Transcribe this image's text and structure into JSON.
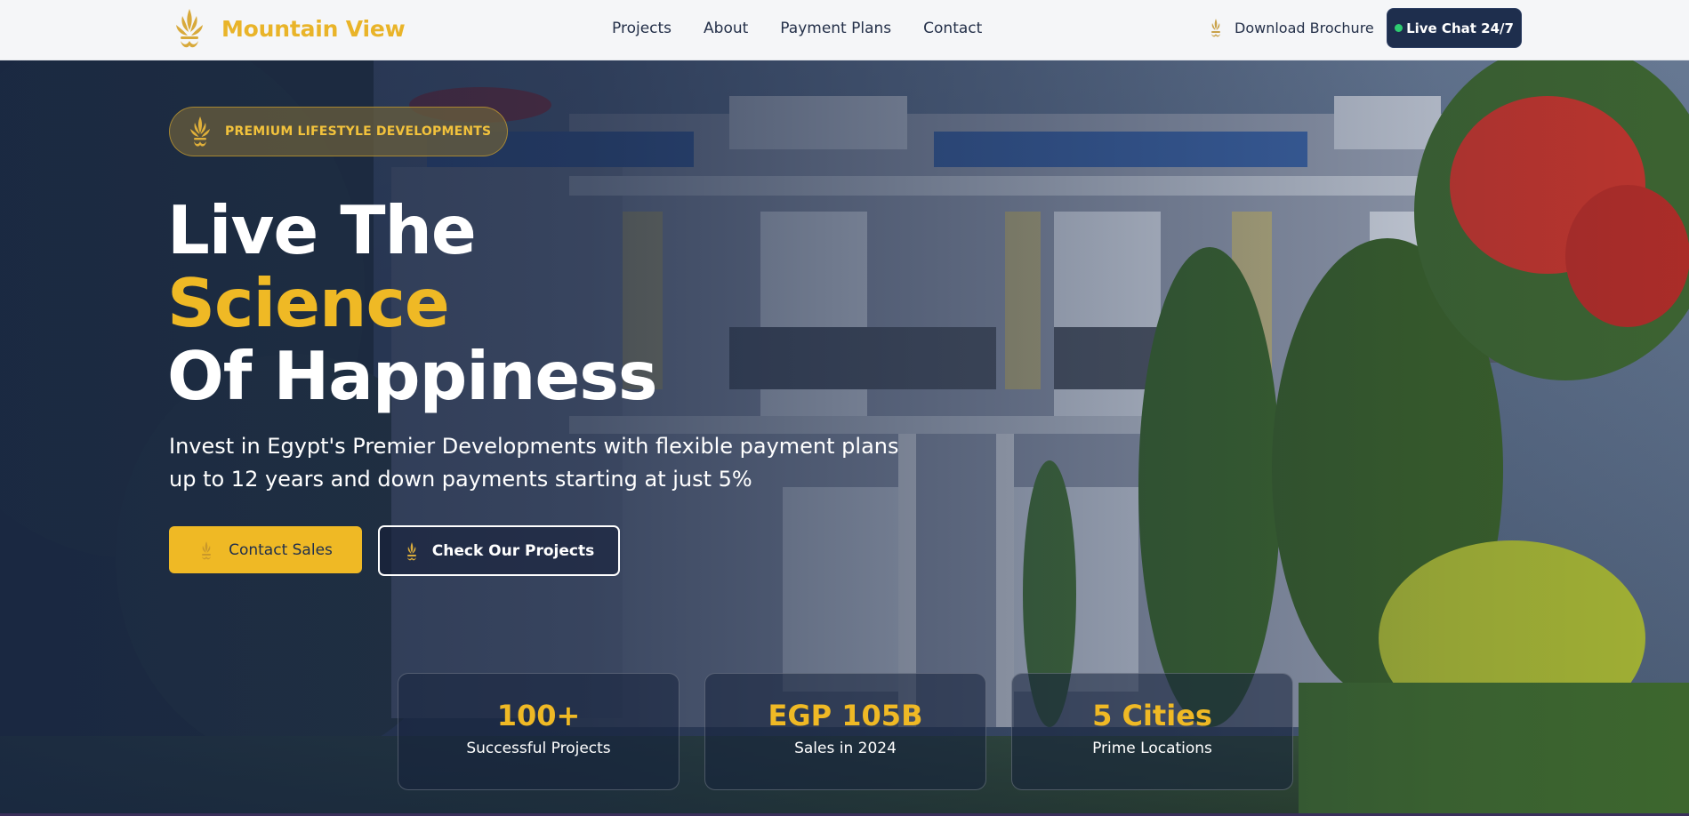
{
  "brand": {
    "name": "Mountain View",
    "logo_icon": "golden-flame-emblem-icon",
    "accent_color": "#e9b429"
  },
  "nav": {
    "links": [
      {
        "label": "Projects"
      },
      {
        "label": "About"
      },
      {
        "label": "Payment Plans"
      },
      {
        "label": "Contact"
      }
    ],
    "download": {
      "label": "Download Brochure",
      "icon": "emblem-icon"
    },
    "live_chat": {
      "label": "Live Chat 24/7",
      "status_color": "#2ecc71",
      "bg_color": "#1e2e4d"
    }
  },
  "hero": {
    "badge": "PREMIUM LIFESTYLE DEVELOPMENTS",
    "headline": {
      "line1": "Live The",
      "line2": "Science",
      "line3": "Of Happiness"
    },
    "subtitle_line1": "Invest in Egypt's Premier Developments with flexible payment plans",
    "subtitle_line2": "up to 12 years and down payments starting at just 5%",
    "primary_button": "Contact Sales",
    "secondary_button": "Check Our Projects",
    "background_image": "luxury-villa-facade-with-trees"
  },
  "stats": [
    {
      "value": "100+",
      "label": "Successful Projects"
    },
    {
      "value": "EGP 105B",
      "label": "Sales in 2024"
    },
    {
      "value": "5 Cities",
      "label": "Prime Locations"
    }
  ],
  "colors": {
    "gold": "#efb925",
    "navy": "#1e2e4d",
    "white": "#ffffff"
  }
}
